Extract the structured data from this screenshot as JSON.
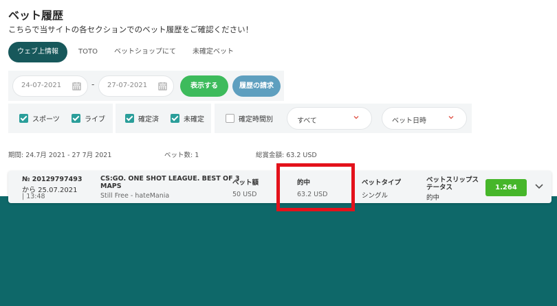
{
  "header": {
    "title": "ベット履歴",
    "subtitle": "こちらで当サイトの各セクションでのベット履歴をご確認ください！"
  },
  "tabs": [
    "ウェブ上情報",
    "TOTO",
    "ベットショップにて",
    "未確定ベット"
  ],
  "active_tab": "ウェブ上情報",
  "filters": {
    "date_from": "24-07-2021",
    "date_separator": "-",
    "date_to": "27-07-2021",
    "show_button": "表示する",
    "request_button": "履歴の請求",
    "checkboxes": [
      {
        "label": "スポーツ",
        "checked": true
      },
      {
        "label": "ライブ",
        "checked": true
      },
      {
        "label": "確定済",
        "checked": true
      },
      {
        "label": "未確定",
        "checked": true
      },
      {
        "label": "確定時間別",
        "checked": false
      }
    ],
    "dropdown_status": "すべて",
    "dropdown_sort": "ベット日時"
  },
  "summary": {
    "period": "期間:  24.7月 2021 - 27 7月 2021",
    "bet_count": "ベット数:  1",
    "total_amount": "総賞金額:  63.2 USD"
  },
  "bet": {
    "number": "№ 20129797493",
    "from_date": "から 25.07.2021",
    "time": "| 13:48",
    "event_line1": "CS:GO. ONE SHOT LEAGUE. BEST OF 3",
    "event_line2": "MAPS",
    "selection": "Still Free - hateMania",
    "stake_label": "ベット額",
    "stake_value": "50 USD",
    "win_label": "的中",
    "win_value": "63.2 USD",
    "type_label": "ベットタイプ",
    "type_value": "シングル",
    "status_label_1": "ベットスリップス",
    "status_label_2": "テータス",
    "status_value": "的中",
    "odds": "1.264"
  },
  "colors": {
    "active_tab": "#17585b",
    "show_button": "#3dbb5c",
    "request_button": "#5e9fbf",
    "checkbox": "#2a9e9a",
    "odds_button": "#46b62a",
    "highlight": "#e3121b",
    "footer": "#0e6869"
  },
  "icons": [
    "calendar-icon",
    "chevron-down-icon",
    "checkmark-icon"
  ]
}
